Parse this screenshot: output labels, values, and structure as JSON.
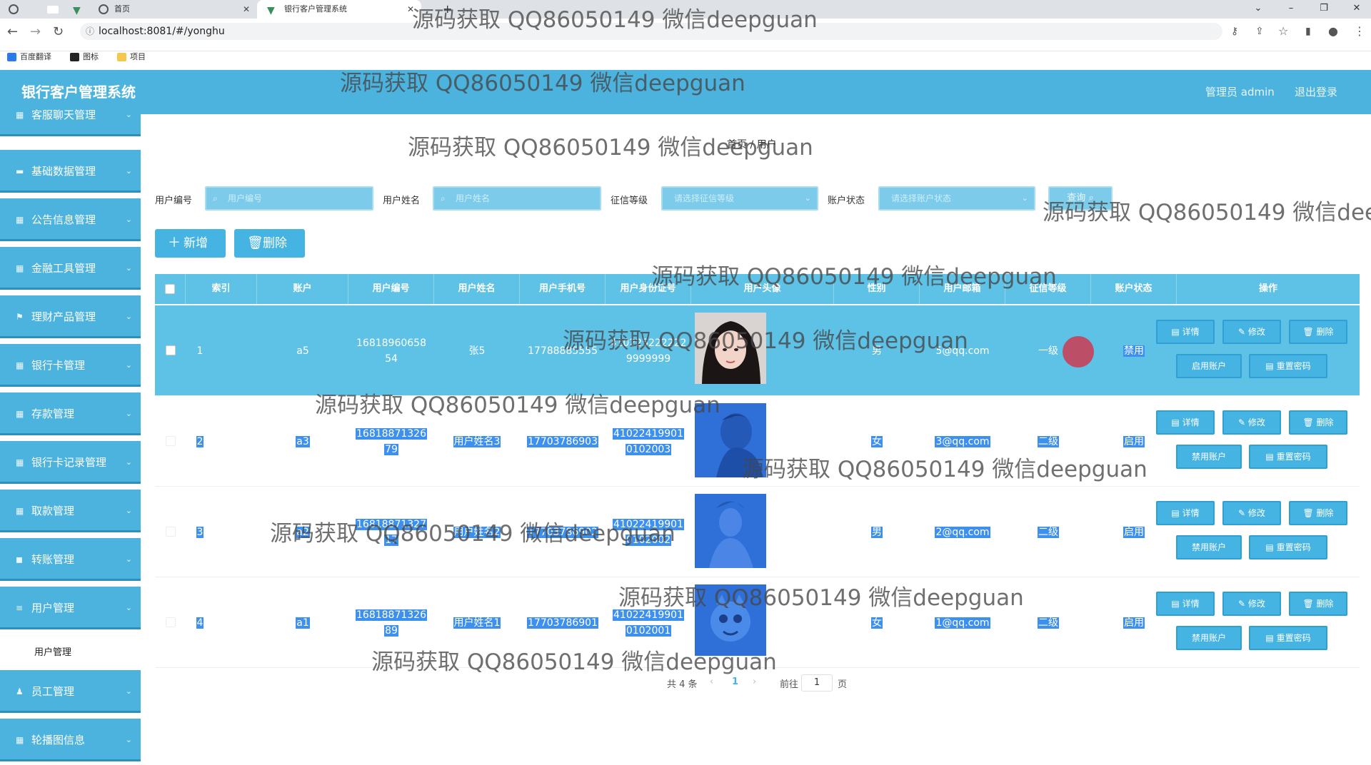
{
  "browser": {
    "tabs": [
      {
        "label": ""
      },
      {
        "label": "首页"
      },
      {
        "label": "银行客户管理系统"
      }
    ],
    "url": "localhost:8081/#/yonghu",
    "bookmarks": [
      "百度翻译",
      "图标",
      "项目"
    ]
  },
  "header": {
    "title": "银行客户管理系统",
    "user": "管理员 admin",
    "logout": "退出登录"
  },
  "sidebar": {
    "items": [
      {
        "label": "客服聊天管理",
        "icon": "grid-icon"
      },
      {
        "label": "基础数据管理",
        "icon": "monitor-icon"
      },
      {
        "label": "公告信息管理",
        "icon": "grid-icon"
      },
      {
        "label": "金融工具管理",
        "icon": "grid-icon"
      },
      {
        "label": "理财产品管理",
        "icon": "flag-icon"
      },
      {
        "label": "银行卡管理",
        "icon": "grid-icon"
      },
      {
        "label": "存款管理",
        "icon": "grid-icon"
      },
      {
        "label": "银行卡记录管理",
        "icon": "grid-icon"
      },
      {
        "label": "取款管理",
        "icon": "grid-icon"
      },
      {
        "label": "转账管理",
        "icon": "bag-icon"
      },
      {
        "label": "用户管理",
        "icon": "menu-icon"
      },
      {
        "label": "员工管理",
        "icon": "person-icon"
      },
      {
        "label": "轮播图信息",
        "icon": "grid-icon"
      }
    ],
    "sub_item": "用户管理"
  },
  "breadcrumb": "首页 / 用户",
  "filters": {
    "user_no_label": "用户编号",
    "user_no_placeholder": "用户编号",
    "user_name_label": "用户姓名",
    "user_name_placeholder": "用户姓名",
    "credit_label": "征信等级",
    "credit_placeholder": "请选择征信等级",
    "status_label": "账户状态",
    "status_placeholder": "请选择账户状态",
    "query_label": "查询"
  },
  "actions": {
    "add": "新增",
    "delete": "删除"
  },
  "table": {
    "columns": [
      "索引",
      "账户",
      "用户编号",
      "用户姓名",
      "用户手机号",
      "用户身份证号",
      "用户头像",
      "性别",
      "用户邮箱",
      "征信等级",
      "账户状态",
      "操作"
    ],
    "rows": [
      {
        "index": "1",
        "account": "a5",
        "no_1": "16818960658",
        "no_2": "54",
        "name": "张5",
        "phone": "17788885555",
        "id_1": "410225222222",
        "id_2": "9999999",
        "gender": "男",
        "email": "5@qq.com",
        "credit": "一级",
        "status": "禁用",
        "toggle": "启用账户"
      },
      {
        "index": "2",
        "account": "a3",
        "no_1": "16818871326",
        "no_2": "79",
        "name": "用户姓名3",
        "phone": "17703786903",
        "id_1": "41022419901",
        "id_2": "0102003",
        "gender": "女",
        "email": "3@qq.com",
        "credit": "二级",
        "status": "启用",
        "toggle": "禁用账户"
      },
      {
        "index": "3",
        "account": "a2",
        "no_1": "16818871327",
        "no_2": "17",
        "name": "用户姓名2",
        "phone": "17703786902",
        "id_1": "41022419901",
        "id_2": "0102002",
        "gender": "男",
        "email": "2@qq.com",
        "credit": "二级",
        "status": "启用",
        "toggle": "禁用账户"
      },
      {
        "index": "4",
        "account": "a1",
        "no_1": "16818871326",
        "no_2": "89",
        "name": "用户姓名1",
        "phone": "17703786901",
        "id_1": "41022419901",
        "id_2": "0102001",
        "gender": "女",
        "email": "1@qq.com",
        "credit": "二级",
        "status": "启用",
        "toggle": "禁用账户"
      }
    ],
    "op_labels": {
      "detail": "详情",
      "edit": "修改",
      "delete": "删除",
      "reset": "重置密码"
    }
  },
  "pagination": {
    "total": "共 4 条",
    "current": "1",
    "goto": "前往",
    "page_value": "1",
    "page_unit": "页"
  },
  "watermark": "源码获取 QQ86050149 微信deepguan",
  "colors": {
    "brand": "#4cb3de",
    "selected": "#3e90ee"
  }
}
